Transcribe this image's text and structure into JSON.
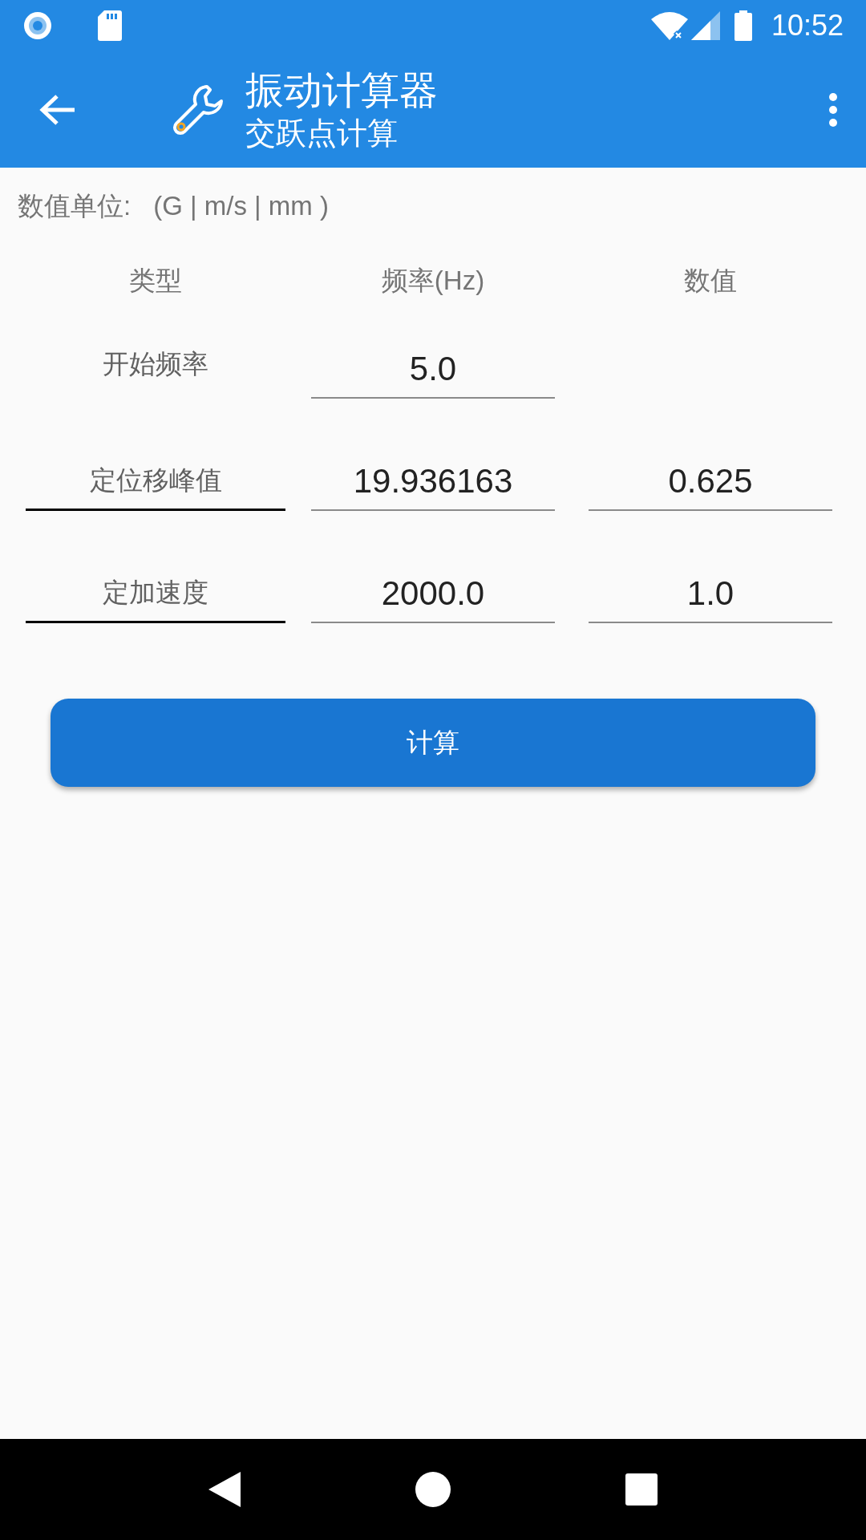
{
  "status_bar": {
    "time": "10:52"
  },
  "app_bar": {
    "title": "振动计算器",
    "subtitle": "交跃点计算"
  },
  "units": {
    "label": "数值单位:",
    "value": "(G | m/s | mm )"
  },
  "columns": [
    "类型",
    "频率(Hz)",
    "数值"
  ],
  "rows": [
    {
      "kind": "label",
      "type": "开始频率",
      "frequency": "5.0"
    },
    {
      "kind": "select",
      "type": "定位移峰值",
      "frequency": "19.936163",
      "value": "0.625"
    },
    {
      "kind": "select",
      "type": "定加速度",
      "frequency": "2000.0",
      "value": "1.0"
    }
  ],
  "button": "计算"
}
